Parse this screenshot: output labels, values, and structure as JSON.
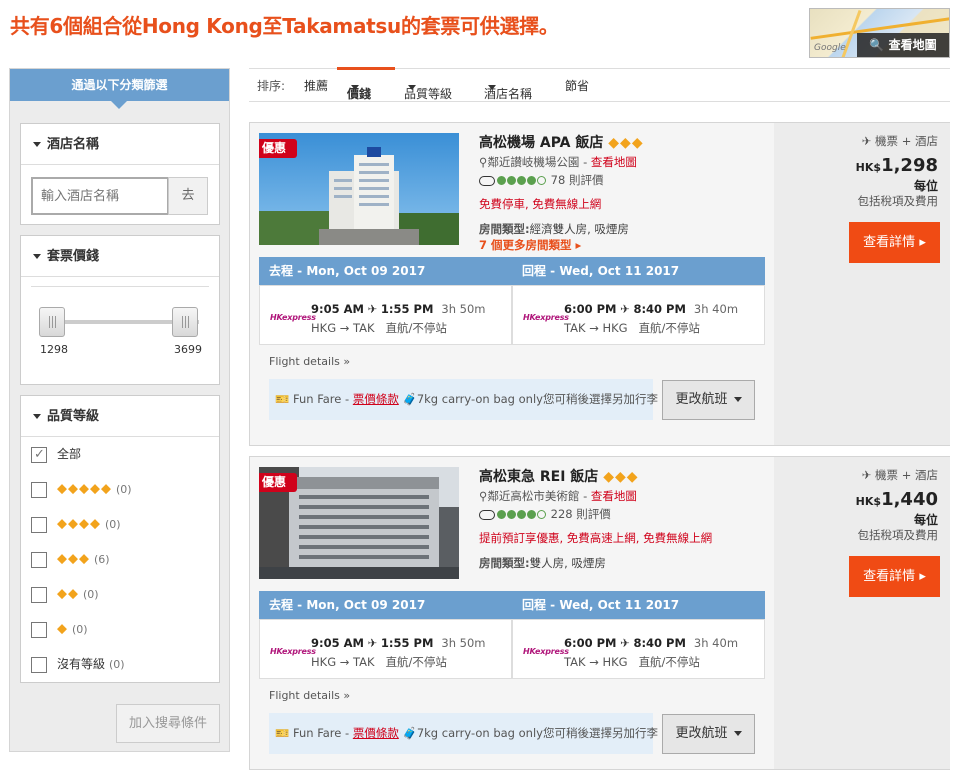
{
  "headline": "共有6個組合從Hong Kong至Takamatsu的套票可供選擇。",
  "map": {
    "google": "Google",
    "button": "查看地圖"
  },
  "sidebar": {
    "header": "通過以下分類篩選",
    "hotel_name": {
      "title": "酒店名稱",
      "placeholder": "輸入酒店名稱",
      "go": "去"
    },
    "price": {
      "title": "套票價錢",
      "min": "1298",
      "max": "3699"
    },
    "rating": {
      "title": "品質等級",
      "items": [
        {
          "label": "全部",
          "stars": "",
          "count": "",
          "checked": true
        },
        {
          "label": "",
          "stars": "◆◆◆◆◆",
          "count": "(0)"
        },
        {
          "label": "",
          "stars": "◆◆◆◆",
          "count": "(0)"
        },
        {
          "label": "",
          "stars": "◆◆◆",
          "count": "(6)"
        },
        {
          "label": "",
          "stars": "◆◆",
          "count": "(0)"
        },
        {
          "label": "",
          "stars": "◆",
          "count": "(0)"
        },
        {
          "label": "沒有等級",
          "stars": "",
          "count": "(0)"
        }
      ]
    },
    "add_button": "加入搜尋條件"
  },
  "sortbar": {
    "label": "排序:",
    "items": [
      "推薦",
      "價錢",
      "品質等級",
      "酒店名稱",
      "節省"
    ]
  },
  "cards": [
    {
      "tag": "優惠",
      "hotel": "高松機場 APA 飯店",
      "stars": "◆◆◆",
      "location": "鄰近讃岐機場公園",
      "map_link": "查看地圖",
      "reviews": "78 則評價",
      "rating_fill": 4,
      "perks": "免費停車, 免費無線上網",
      "room_label": "房間類型:",
      "room_type": "經濟雙人房, 吸煙房",
      "more_rooms": "7 個更多房間類型",
      "outbound": {
        "head": "去程 - Mon, Oct 09 2017",
        "dep": "9:05 AM",
        "arr": "1:55 PM",
        "dur": "3h 50m",
        "route": "HKG → TAK",
        "type": "直航/不停站"
      },
      "inbound": {
        "head": "回程 - Wed, Oct 11 2017",
        "dep": "6:00 PM",
        "arr": "8:40 PM",
        "dur": "3h 40m",
        "route": "TAK → HKG",
        "type": "直航/不停站"
      },
      "airline": "HKexpress",
      "flight_details": "Flight details",
      "fare_name": "Fun Fare - ",
      "fare_link": "票價條款",
      "bag": "7kg carry-on bag only您可稍後選擇另加行李",
      "change": "更改航班",
      "package": "機票 + 酒店",
      "currency": "HK$",
      "price": "1,298",
      "per": "每位",
      "tax": "包括稅項及費用",
      "view": "查看詳情"
    },
    {
      "tag": "優惠",
      "hotel": "高松東急 REI 飯店",
      "stars": "◆◆◆",
      "location": "鄰近高松市美術館",
      "map_link": "查看地圖",
      "reviews": "228 則評價",
      "rating_fill": 4,
      "perks": "提前預訂享優惠, 免費高速上網, 免費無線上網",
      "room_label": "房間類型:",
      "room_type": "雙人房, 吸煙房",
      "more_rooms": "",
      "outbound": {
        "head": "去程 - Mon, Oct 09 2017",
        "dep": "9:05 AM",
        "arr": "1:55 PM",
        "dur": "3h 50m",
        "route": "HKG → TAK",
        "type": "直航/不停站"
      },
      "inbound": {
        "head": "回程 - Wed, Oct 11 2017",
        "dep": "6:00 PM",
        "arr": "8:40 PM",
        "dur": "3h 40m",
        "route": "TAK → HKG",
        "type": "直航/不停站"
      },
      "airline": "HKexpress",
      "flight_details": "Flight details",
      "fare_name": "Fun Fare - ",
      "fare_link": "票價條款",
      "bag": "7kg carry-on bag only您可稍後選擇另加行李",
      "change": "更改航班",
      "package": "機票 + 酒店",
      "currency": "HK$",
      "price": "1,440",
      "per": "每位",
      "tax": "包括稅項及費用",
      "view": "查看詳情"
    }
  ],
  "colors": {
    "accent": "#e8501c",
    "filter_blue": "#6b9fcf",
    "deal_red": "#d0021b",
    "view_button": "#f04b14",
    "star_gold": "#f2a31c"
  }
}
